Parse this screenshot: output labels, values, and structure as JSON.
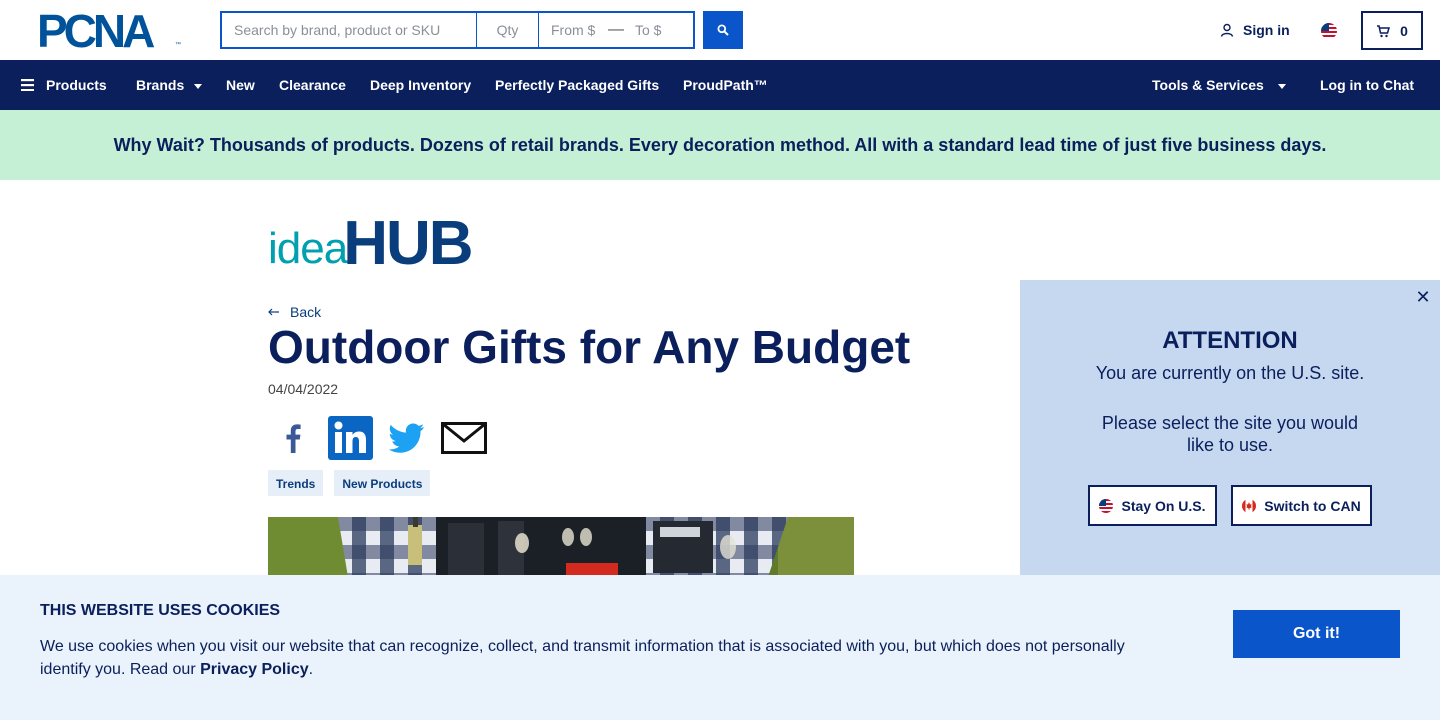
{
  "header": {
    "logo_text": "PCNA",
    "logo_tm": "™",
    "search_placeholder": "Search by brand, product or SKU",
    "qty_placeholder": "Qty",
    "from_placeholder": "From $",
    "to_placeholder": "To $",
    "range_separator": "—",
    "sign_in_label": "Sign in",
    "cart_count": "0"
  },
  "nav": {
    "items": [
      {
        "label": "Products",
        "icon": "hamburger-icon"
      },
      {
        "label": "Brands",
        "icon": "caret-down-icon"
      },
      {
        "label": "New"
      },
      {
        "label": "Clearance"
      },
      {
        "label": "Deep Inventory"
      },
      {
        "label": "Perfectly Packaged Gifts"
      },
      {
        "label": "ProudPath™"
      },
      {
        "label": "Tools & Services",
        "icon": "caret-down-icon"
      },
      {
        "label": "Log in to Chat"
      }
    ]
  },
  "banner": {
    "text": "Why Wait? Thousands of products. Dozens of retail brands. Every decoration method. All with a standard lead time of just five business days."
  },
  "article": {
    "section_logo_idea": "idea",
    "section_logo_hub": "HUB",
    "back_label": "Back",
    "title": "Outdoor Gifts for Any Budget",
    "date": "04/04/2022",
    "share_icons": [
      "facebook-icon",
      "linkedin-icon",
      "twitter-icon",
      "email-icon"
    ],
    "tags": [
      "Trends",
      "New Products"
    ]
  },
  "site_modal": {
    "title": "ATTENTION",
    "line1": "You are currently on the U.S. site.",
    "line2": "Please select the site you would like to use.",
    "stay_label": "Stay On U.S.",
    "switch_label": "Switch to CAN",
    "close_glyph": "✕"
  },
  "cookie_bar": {
    "title": "THIS WEBSITE USES COOKIES",
    "text_before": "We use cookies when you visit our website that can recognize, collect, and transmit information that is associated with you, but which does not personally identify you. Read our ",
    "link_label": "Privacy Policy",
    "text_after": ".",
    "accept_label": "Got it!"
  },
  "colors": {
    "brand_navy": "#0a1f5c",
    "brand_blue": "#0a55c9",
    "banner_green": "#c6f0d6",
    "modal_bg": "#c6d8f0",
    "cookie_bg": "#eaf2fb",
    "idea_teal": "#00a0b0"
  }
}
